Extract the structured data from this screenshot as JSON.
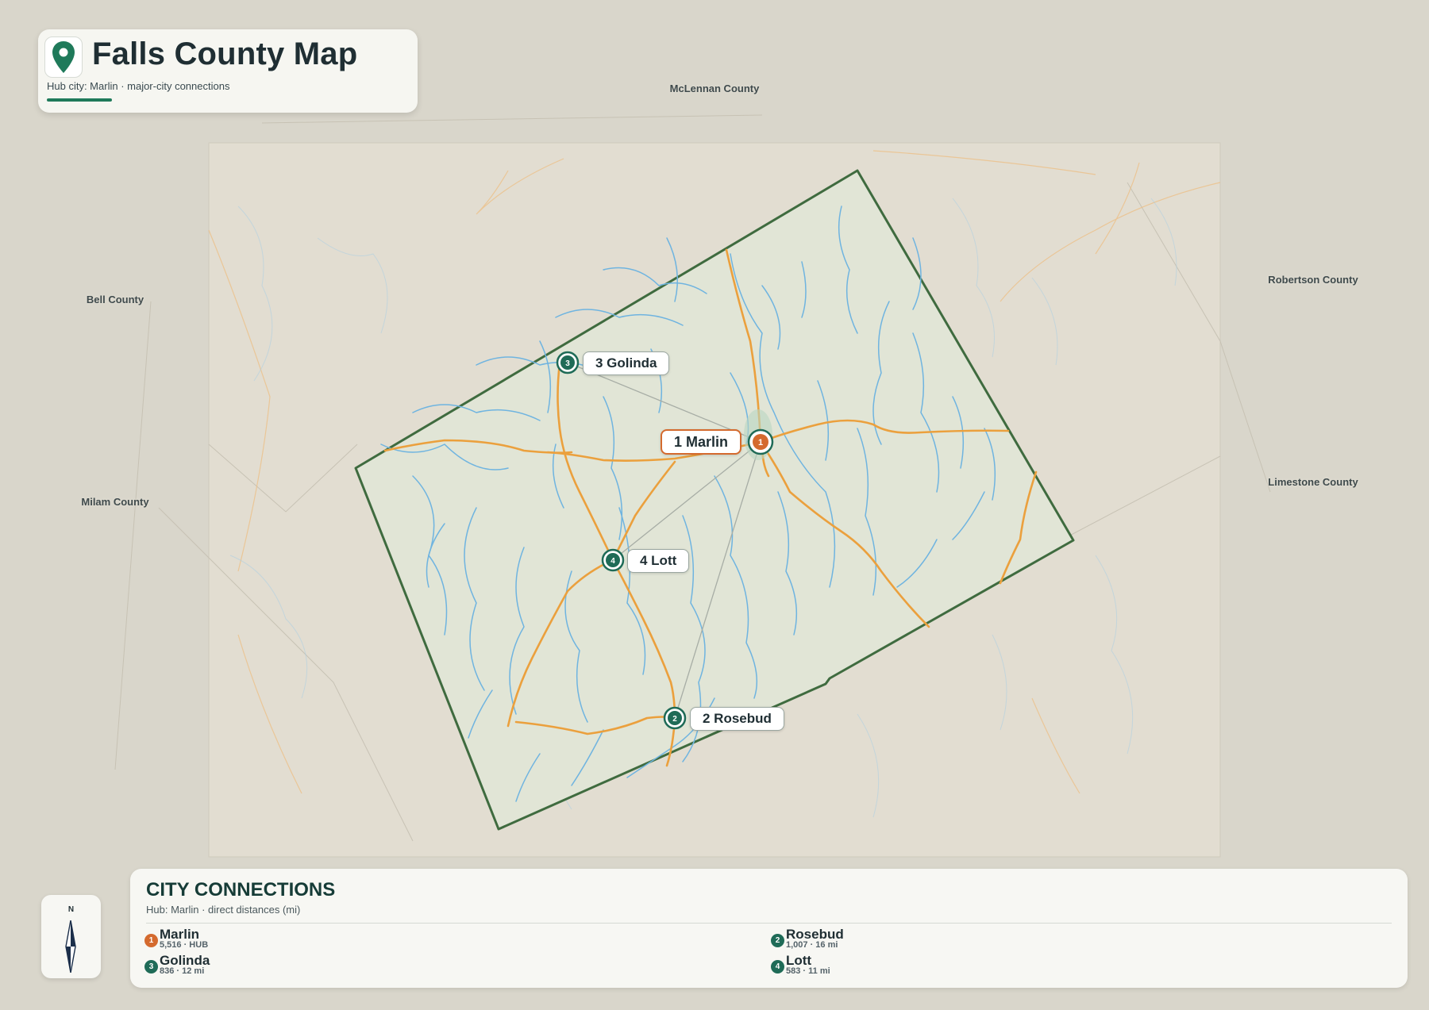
{
  "header": {
    "title": "Falls County Map",
    "subtitle": "Hub city: Marlin · major-city connections",
    "pin_icon": "map-pin-icon"
  },
  "colors": {
    "accent": "#1f7a5a",
    "hub": "#d46a2e",
    "city": "#1f6b57",
    "boundary": "#3f6b3f",
    "roads": "#eba03d",
    "streams": "#6fb4e0"
  },
  "county_labels": {
    "mclennan": "McLennan County",
    "bell": "Bell County",
    "milam": "Milam County",
    "robertson": "Robertson County",
    "limestone": "Limestone County"
  },
  "cities": [
    {
      "num": "1",
      "label": "1 Marlin",
      "type": "hub"
    },
    {
      "num": "2",
      "label": "2 Rosebud",
      "type": "city"
    },
    {
      "num": "3",
      "label": "3 Golinda",
      "type": "city"
    },
    {
      "num": "4",
      "label": "4 Lott",
      "type": "city"
    }
  ],
  "compass": {
    "label": "N",
    "icon": "compass-icon"
  },
  "panel": {
    "title": "CITY CONNECTIONS",
    "subtitle": "Hub: Marlin · direct distances (mi)",
    "connections": [
      {
        "num": "1",
        "name": "Marlin",
        "detail": "5,516 · HUB"
      },
      {
        "num": "2",
        "name": "Rosebud",
        "detail": "1,007 · 16 mi"
      },
      {
        "num": "3",
        "name": "Golinda",
        "detail": "836 · 12 mi"
      },
      {
        "num": "4",
        "name": "Lott",
        "detail": "583 · 11 mi"
      }
    ]
  }
}
